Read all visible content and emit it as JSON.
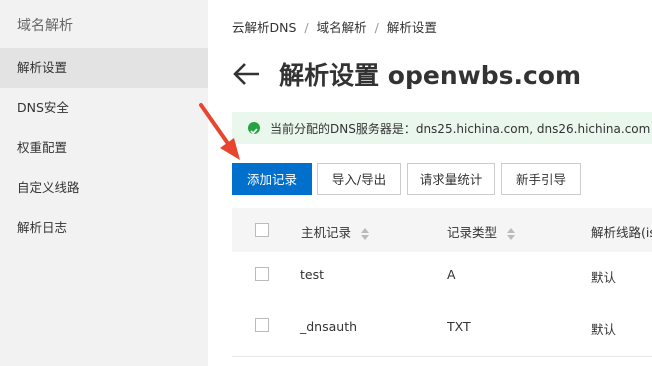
{
  "sidebar": {
    "title": "域名解析",
    "items": [
      {
        "label": "解析设置",
        "active": true
      },
      {
        "label": "DNS安全",
        "active": false
      },
      {
        "label": "权重配置",
        "active": false
      },
      {
        "label": "自定义线路",
        "active": false
      },
      {
        "label": "解析日志",
        "active": false
      }
    ]
  },
  "breadcrumb": [
    "云解析DNS",
    "域名解析",
    "解析设置"
  ],
  "breadcrumb_sep": "/",
  "page": {
    "title": "解析设置 openwbs.com",
    "back_icon": "arrow-left-icon"
  },
  "notice": {
    "icon": "check-circle-icon",
    "text": "当前分配的DNS服务器是：dns25.hichina.com, dns26.hichina.com",
    "color": "#27a242"
  },
  "toolbar": {
    "add_label": "添加记录",
    "import_export_label": "导入/导出",
    "stats_label": "请求量统计",
    "guide_label": "新手引导"
  },
  "table": {
    "columns": [
      "主机记录",
      "记录类型",
      "解析线路(isp"
    ],
    "rows": [
      {
        "host": "test",
        "type": "A",
        "line": "默认"
      },
      {
        "host": "_dnsauth",
        "type": "TXT",
        "line": "默认"
      }
    ]
  },
  "colors": {
    "primary": "#0070cc",
    "arrow": "#e8452f",
    "notice_bg": "#e9f7ec"
  }
}
